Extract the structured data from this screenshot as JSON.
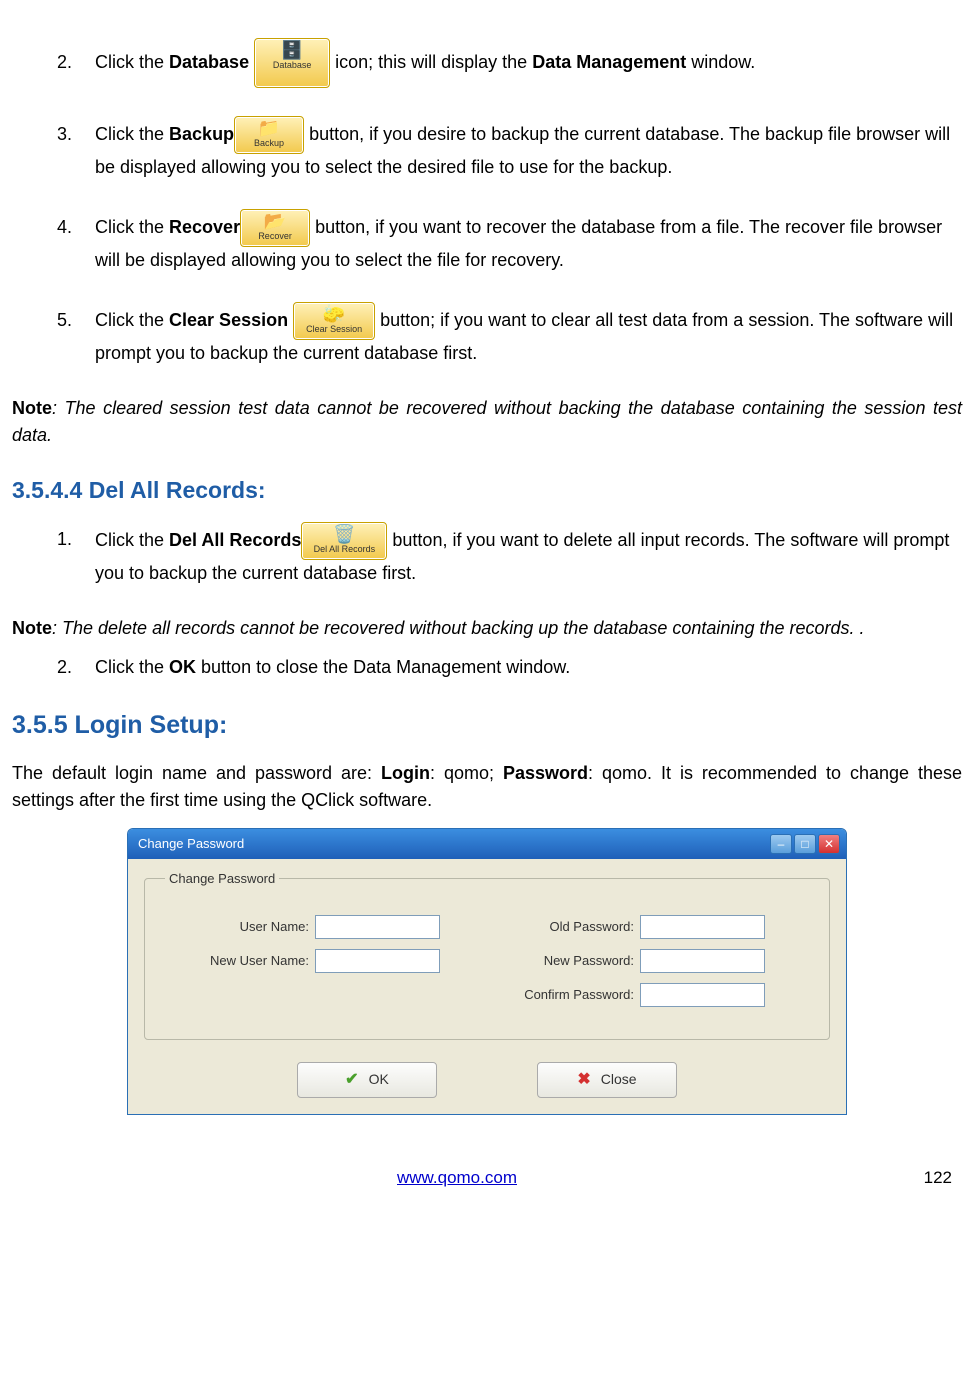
{
  "steps1": {
    "s2": {
      "num": "2.",
      "pre": "Click the ",
      "bold": "Database",
      "iconLabel": "Database",
      "post": " icon; this will display the ",
      "bold2": "Data Management",
      "post2": " window."
    },
    "s3": {
      "num": "3.",
      "pre": "Click the ",
      "bold": "Backup",
      "iconLabel": "Backup",
      "post": " button, if you desire to backup the current database. The backup file browser will be displayed allowing you to select the desired file to use for the backup."
    },
    "s4": {
      "num": "4.",
      "pre": "Click the ",
      "bold": "Recover",
      "iconLabel": "Recover",
      "post": " button, if you want to recover the database from a file. The recover file browser will be displayed allowing you to select the file for recovery."
    },
    "s5": {
      "num": "5.",
      "pre": "Click the ",
      "bold": "Clear Session",
      "iconLabel": "Clear Session",
      "post": " button; if you want to clear all test data from a session. The software will prompt you to backup the current database first."
    }
  },
  "note1": {
    "label": "Note",
    "text": ": The cleared session test data cannot be recovered without backing the database containing the session test data."
  },
  "heading1": "3.5.4.4 Del All Records:",
  "steps2": {
    "s1": {
      "num": "1.",
      "pre": "Click the ",
      "bold": "Del All Records",
      "iconLabel": "Del All Records",
      "post": " button, if you want to delete all input records. The software will prompt you to backup the current database first."
    },
    "s2": {
      "num": "2.",
      "pre": "Click the ",
      "bold": "OK",
      "post": " button to close the Data Management window."
    }
  },
  "note2": {
    "label": "Note",
    "text": ": The delete all records cannot be recovered without backing up the database containing the records. ."
  },
  "heading2": "3.5.5 Login Setup:",
  "loginIntro": {
    "pre": "The default login name and password are: ",
    "loginLabel": "Login",
    "loginVal": ": qomo; ",
    "pwdLabel": "Password",
    "pwdVal": ": qomo. It is recommended to change these settings after the first time using the QClick software."
  },
  "dialog": {
    "title": "Change Password",
    "legend": "Change Password",
    "labels": {
      "userName": "User Name:",
      "oldPwd": "Old Password:",
      "newUser": "New User Name:",
      "newPwd": "New Password:",
      "confirmPwd": "Confirm Password:"
    },
    "ok": "OK",
    "close": "Close"
  },
  "footer": {
    "link": "www.qomo.com",
    "page": "122"
  }
}
